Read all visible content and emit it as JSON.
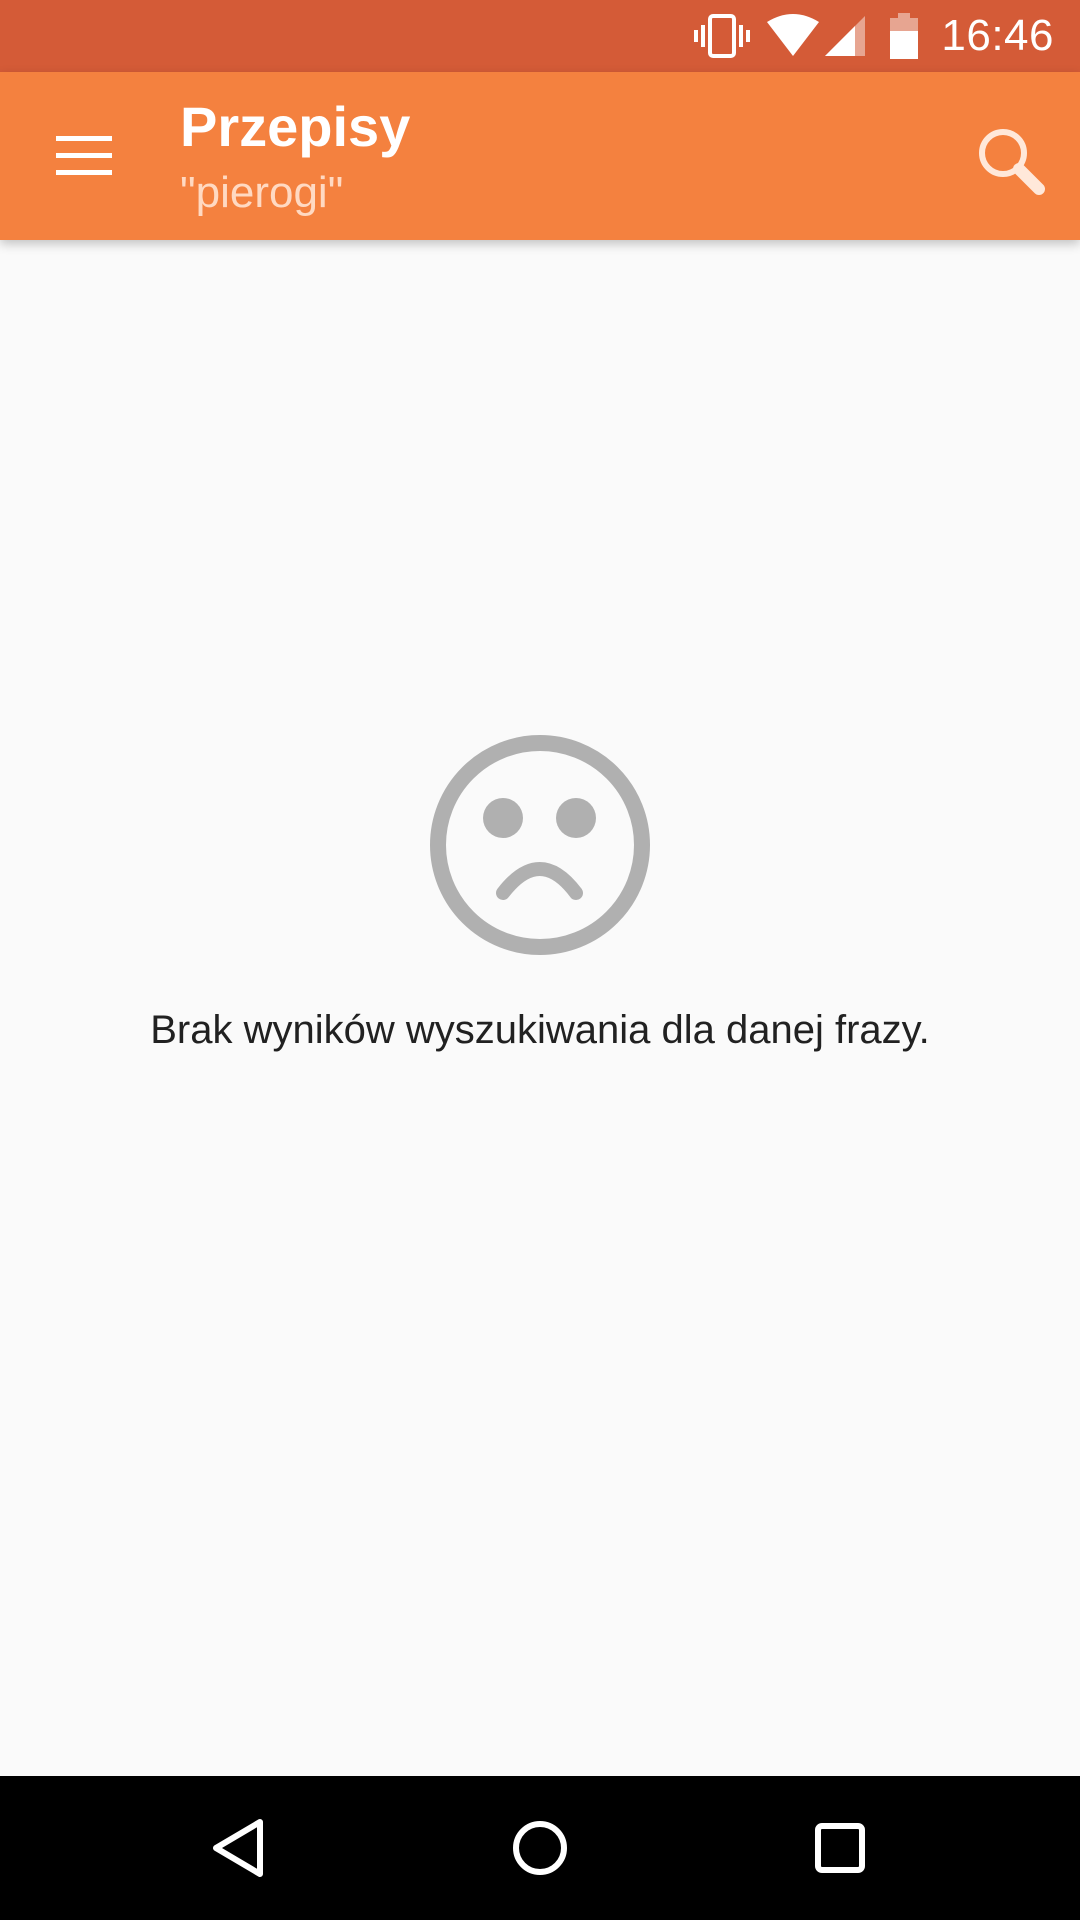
{
  "status_bar": {
    "time": "16:46",
    "icons": [
      "vibrate-icon",
      "wifi-icon",
      "cell-signal-icon",
      "battery-icon"
    ],
    "color": "#d45b37"
  },
  "app_bar": {
    "title": "Przepisy",
    "subtitle": "\"pierogi\"",
    "menu_icon": "hamburger-menu-icon",
    "search_icon": "search-icon",
    "color": "#f4813f"
  },
  "empty_state": {
    "icon": "sad-face-icon",
    "message": "Brak wyników wyszukiwania dla danej frazy."
  },
  "nav_bar": {
    "icons": [
      "back-icon",
      "home-icon",
      "recents-icon"
    ]
  }
}
